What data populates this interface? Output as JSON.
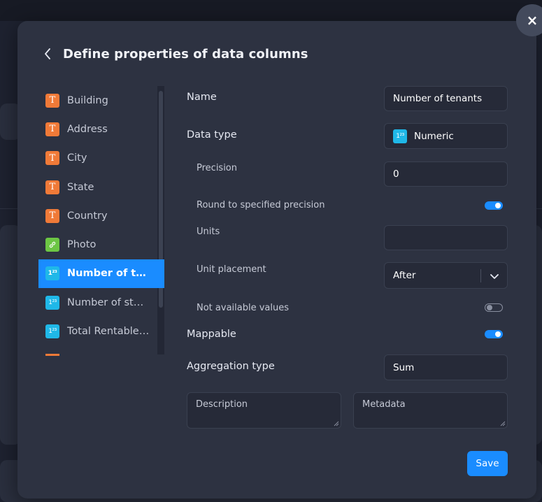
{
  "modal": {
    "title": "Define properties of data columns",
    "close_glyph": "×"
  },
  "columns": [
    {
      "label": "Building",
      "icon": "text-type-icon",
      "glyph": "T",
      "kind": "text"
    },
    {
      "label": "Address",
      "icon": "text-type-icon",
      "glyph": "T",
      "kind": "text"
    },
    {
      "label": "City",
      "icon": "text-type-icon",
      "glyph": "T",
      "kind": "text"
    },
    {
      "label": "State",
      "icon": "text-type-icon",
      "glyph": "T",
      "kind": "text"
    },
    {
      "label": "Country",
      "icon": "text-type-icon",
      "glyph": "T",
      "kind": "text"
    },
    {
      "label": "Photo",
      "icon": "link-type-icon",
      "glyph": "🔗",
      "kind": "link"
    },
    {
      "label": "Number of ten...",
      "icon": "numeric-type-icon",
      "glyph": "1²³",
      "kind": "num",
      "active": true
    },
    {
      "label": "Number of stor...",
      "icon": "numeric-type-icon",
      "glyph": "1²³",
      "kind": "num"
    },
    {
      "label": "Total Rentable ...",
      "icon": "numeric-type-icon",
      "glyph": "1²³",
      "kind": "num"
    }
  ],
  "form": {
    "name_label": "Name",
    "name_value": "Number of tenants",
    "data_type_label": "Data type",
    "data_type_value": "Numeric",
    "data_type_glyph": "1²³",
    "precision_label": "Precision",
    "precision_value": "0",
    "round_label": "Round to specified precision",
    "round_on": true,
    "units_label": "Units",
    "units_value": "",
    "unit_placement_label": "Unit placement",
    "unit_placement_value": "After",
    "na_label": "Not available values",
    "na_on": false,
    "mappable_label": "Mappable",
    "mappable_on": true,
    "aggregation_label": "Aggregation type",
    "aggregation_value": "Sum",
    "description_placeholder": "Description",
    "metadata_placeholder": "Metadata",
    "save_label": "Save"
  },
  "colors": {
    "accent": "#1a8cff",
    "text_type": "#f07a38",
    "link_type": "#6cc644",
    "numeric_type": "#1fb8e8",
    "modal_bg": "#2d3241"
  }
}
